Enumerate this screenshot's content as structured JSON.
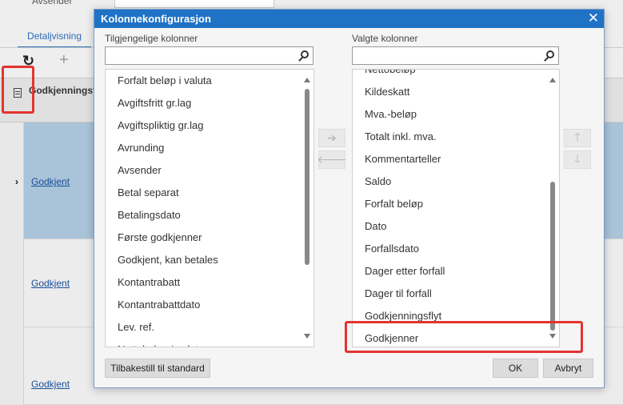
{
  "background": {
    "top_field_label": "Avsender",
    "tab_label": "Detaljvisning",
    "refresh_glyph": "↻",
    "plus_glyph": "+",
    "column_header": "Godkjenningsflyt",
    "row_arrow": "›",
    "rows": [
      {
        "status": "Godkjent"
      },
      {
        "status": "Godkjent"
      },
      {
        "status": "Godkjent"
      }
    ]
  },
  "dialog": {
    "title": "Kolonnekonfigurasjon",
    "close_glyph": "✕",
    "available": {
      "label": "Tilgjengelige kolonner",
      "search_value": "",
      "items": [
        "Forfalt beløp i valuta",
        "Avgiftsfritt gr.lag",
        "Avgiftspliktig gr.lag",
        "Avrunding",
        "Avsender",
        "Betal separat",
        "Betalingsdato",
        "Første godkjenner",
        "Godkjent, kan betales",
        "Kontantrabatt",
        "Kontantrabattdato",
        "Lev. ref.",
        "Nettobeløp i valuta"
      ]
    },
    "selected": {
      "label": "Valgte kolonner",
      "search_value": "",
      "items": [
        "Nettobeløp",
        "Kildeskatt",
        "Mva.-beløp",
        "Totalt inkl. mva.",
        "Kommentarteller",
        "Saldo",
        "Forfalt beløp",
        "Dato",
        "Forfallsdato",
        "Dager etter forfall",
        "Dager til forfall",
        "Godkjenningsflyt",
        "Godkjenner"
      ]
    },
    "move_buttons": {
      "add_glyph": "➔",
      "remove_glyph": "🡐",
      "up_glyph": "🡑",
      "down_glyph": "🡓"
    },
    "buttons": {
      "reset": "Tilbakestill til standard",
      "ok": "OK",
      "cancel": "Avbryt"
    }
  },
  "colors": {
    "titlebar": "#1f72c5",
    "highlight": "#e3342f",
    "selected_row": "#a9c3d9",
    "link": "#1a4f99"
  },
  "icons": {
    "search": "search-icon",
    "column_config": "column-config-icon",
    "close": "close-icon"
  }
}
